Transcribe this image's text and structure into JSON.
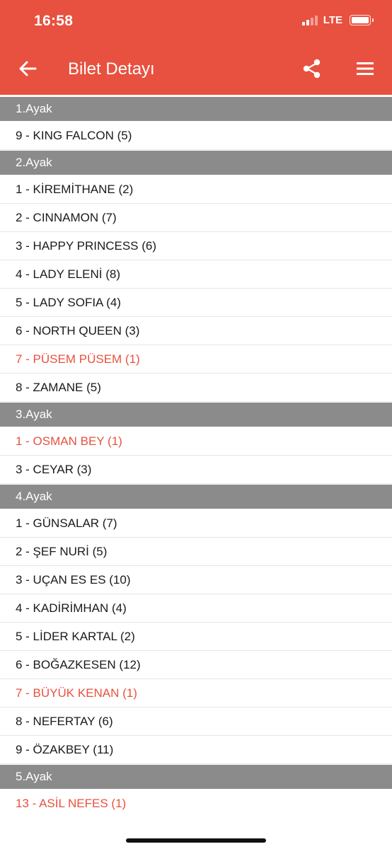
{
  "status_bar": {
    "time": "16:58",
    "network": "LTE"
  },
  "header": {
    "title": "Bilet Detayı"
  },
  "colors": {
    "accent": "#e8513f",
    "section": "#8b8b8b",
    "winner_text": "#e8513f"
  },
  "sections": [
    {
      "title": "1.Ayak",
      "rows": [
        {
          "text": "9 - KING FALCON (5)",
          "hit": false
        }
      ]
    },
    {
      "title": "2.Ayak",
      "rows": [
        {
          "text": "1 - KİREMİTHANE (2)",
          "hit": false
        },
        {
          "text": "2 - CINNAMON (7)",
          "hit": false
        },
        {
          "text": "3 - HAPPY PRINCESS (6)",
          "hit": false
        },
        {
          "text": "4 - LADY ELENİ (8)",
          "hit": false
        },
        {
          "text": "5 - LADY SOFIA (4)",
          "hit": false
        },
        {
          "text": "6 - NORTH QUEEN (3)",
          "hit": false
        },
        {
          "text": "7 - PÜSEM PÜSEM (1)",
          "hit": true
        },
        {
          "text": "8 - ZAMANE (5)",
          "hit": false
        }
      ]
    },
    {
      "title": "3.Ayak",
      "rows": [
        {
          "text": "1 - OSMAN BEY (1)",
          "hit": true
        },
        {
          "text": "3 - CEYAR (3)",
          "hit": false
        }
      ]
    },
    {
      "title": "4.Ayak",
      "rows": [
        {
          "text": "1 - GÜNSALAR (7)",
          "hit": false
        },
        {
          "text": "2 - ŞEF NURİ (5)",
          "hit": false
        },
        {
          "text": "3 - UÇAN ES ES (10)",
          "hit": false
        },
        {
          "text": "4 - KADİRİMHAN (4)",
          "hit": false
        },
        {
          "text": "5 - LİDER KARTAL (2)",
          "hit": false
        },
        {
          "text": "6 - BOĞAZKESEN (12)",
          "hit": false
        },
        {
          "text": "7 - BÜYÜK KENAN (1)",
          "hit": true
        },
        {
          "text": "8 - NEFERTAY (6)",
          "hit": false
        },
        {
          "text": "9 - ÖZAKBEY (11)",
          "hit": false
        }
      ]
    },
    {
      "title": "5.Ayak",
      "rows": [
        {
          "text": "13 - ASİL NEFES (1)",
          "hit": true
        }
      ]
    }
  ]
}
